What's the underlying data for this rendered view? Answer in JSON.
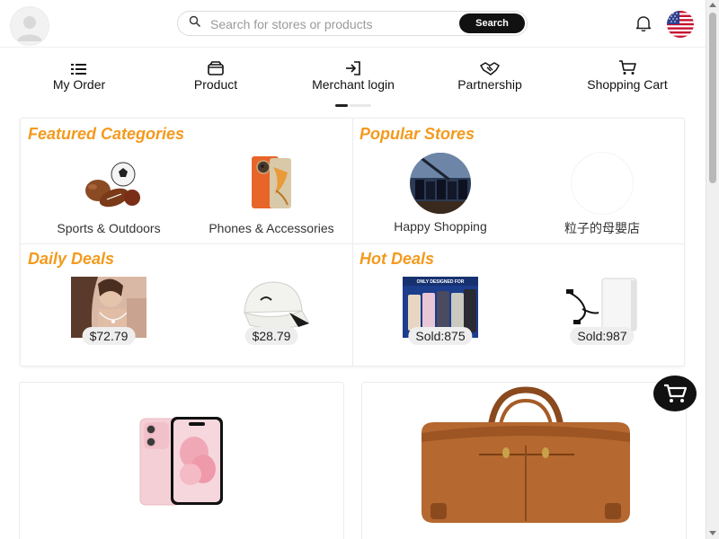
{
  "header": {
    "avatar_icon": "user-avatar-icon",
    "search": {
      "placeholder": "Search for stores or products",
      "value": "",
      "button_label": "Search",
      "icon": "search-icon"
    },
    "notification_icon": "bell-icon",
    "language_icon": "us-flag-icon"
  },
  "nav": {
    "items": [
      {
        "label": "My Order",
        "icon": "list-icon"
      },
      {
        "label": "Product",
        "icon": "box-icon"
      },
      {
        "label": "Merchant login",
        "icon": "login-icon"
      },
      {
        "label": "Partnership",
        "icon": "handshake-icon"
      },
      {
        "label": "Shopping Cart",
        "icon": "cart-icon"
      }
    ],
    "pager": {
      "pages": 2,
      "active": 1
    }
  },
  "featured_categories": {
    "title": "Featured Categories",
    "items": [
      {
        "label": "Sports & Outdoors"
      },
      {
        "label": "Phones & Accessories"
      }
    ]
  },
  "popular_stores": {
    "title": "Popular Stores",
    "items": [
      {
        "label": "Happy Shopping"
      },
      {
        "label": "粒子的母嬰店"
      }
    ]
  },
  "daily_deals": {
    "title": "Daily Deals",
    "items": [
      {
        "price": "$72.79"
      },
      {
        "price": "$28.79"
      }
    ]
  },
  "hot_deals": {
    "title": "Hot Deals",
    "items": [
      {
        "sold": "Sold:875",
        "banner_text": "ONLY DESIGNED FOR"
      },
      {
        "sold": "Sold:987"
      }
    ]
  },
  "products": [
    {
      "image": "pink-smartphone"
    },
    {
      "image": "brown-leather-duffel-bag"
    }
  ],
  "floating_cart_icon": "cart-icon",
  "colors": {
    "accent": "#f39a1e",
    "button": "#111111",
    "background": "#ffffff"
  }
}
